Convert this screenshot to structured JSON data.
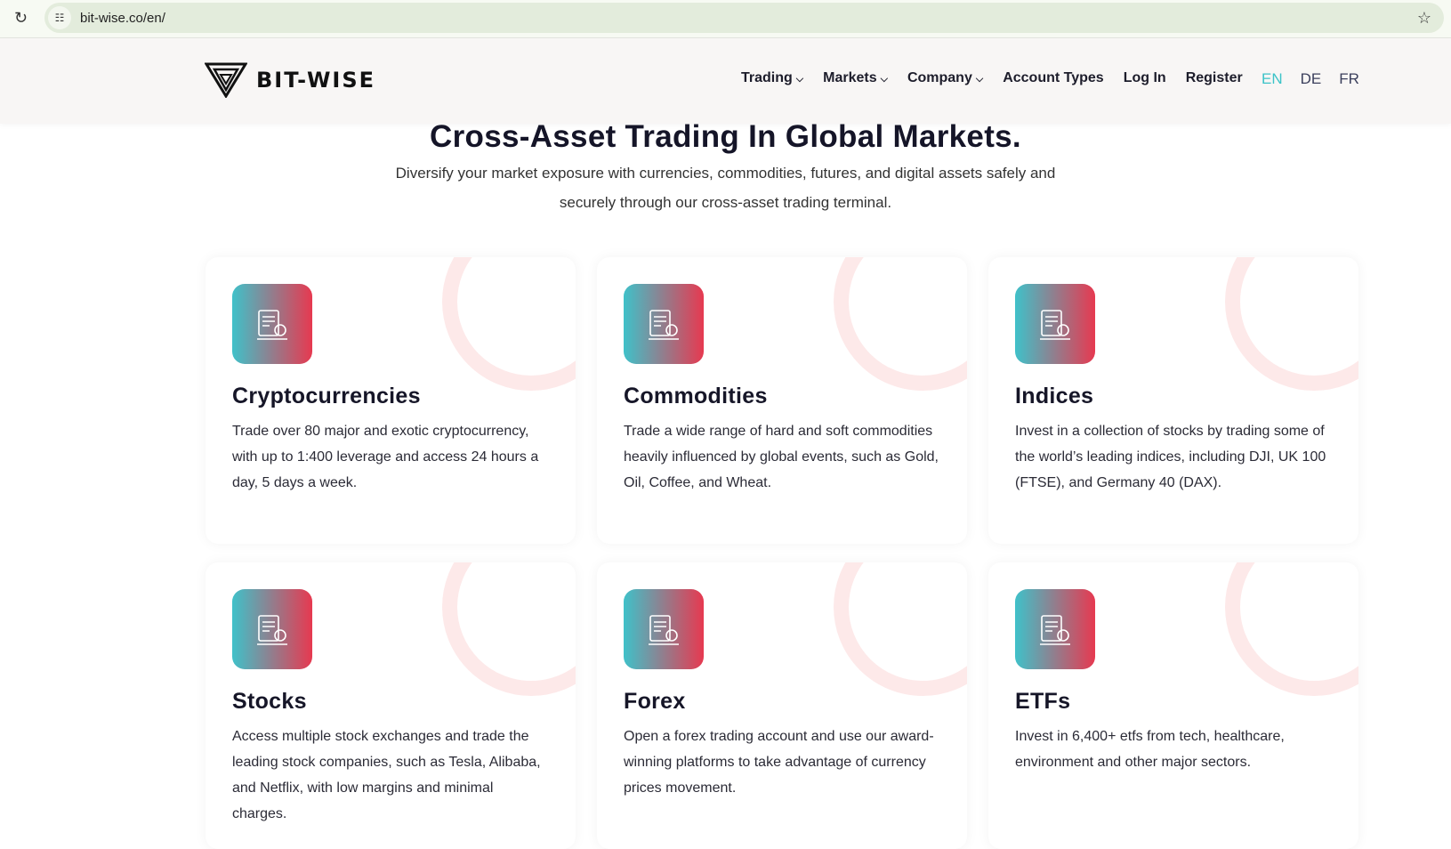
{
  "browser": {
    "url": "bit-wise.co/en/"
  },
  "brand": {
    "name": "BIT-WISE"
  },
  "nav": [
    {
      "label": "Trading",
      "dropdown": true
    },
    {
      "label": "Markets",
      "dropdown": true
    },
    {
      "label": "Company",
      "dropdown": true
    },
    {
      "label": "Account Types"
    },
    {
      "label": "Log In"
    },
    {
      "label": "Register"
    }
  ],
  "languages": [
    {
      "label": "EN",
      "active": true
    },
    {
      "label": "DE"
    },
    {
      "label": "FR"
    }
  ],
  "hero": {
    "title": "Cross-Asset Trading In Global Markets.",
    "subtitle": "Diversify your market exposure with currencies, commodities, futures, and digital assets safely and securely through our cross-asset trading terminal."
  },
  "colors": {
    "accent": "#3cc3c8",
    "gradient_start": "#3fc1c9",
    "gradient_end": "#e73950"
  },
  "cards": [
    {
      "title": "Cryptocurrencies",
      "icon": "growth-gear-icon",
      "text": "Trade over 80 major and exotic cryptocurrency, with up to 1:400 leverage and access 24 hours a day, 5 days a week."
    },
    {
      "title": "Commodities",
      "icon": "code-document-icon",
      "text": "Trade a wide range of hard and soft commodities heavily influenced by global events, such as Gold, Oil, Coffee, and Wheat."
    },
    {
      "title": "Indices",
      "icon": "megaphone-icon",
      "text": "Invest in a collection of stocks by trading some of the world’s leading indices, including DJI, UK 100 (FTSE), and Germany 40 (DAX)."
    },
    {
      "title": "Stocks",
      "icon": "shopping-document-icon",
      "text": "Access multiple stock exchanges and trade the leading stock companies, such as Tesla, Alibaba, and Netflix, with low margins and minimal charges."
    },
    {
      "title": "Forex",
      "icon": "monitor-edit-icon",
      "text": "Open a forex trading account and use our award-winning platforms to take advantage of currency prices movement."
    },
    {
      "title": "ETFs",
      "icon": "laptop-user-icon",
      "text": "Invest in 6,400+ etfs from tech, healthcare, environment and other major sectors."
    }
  ]
}
